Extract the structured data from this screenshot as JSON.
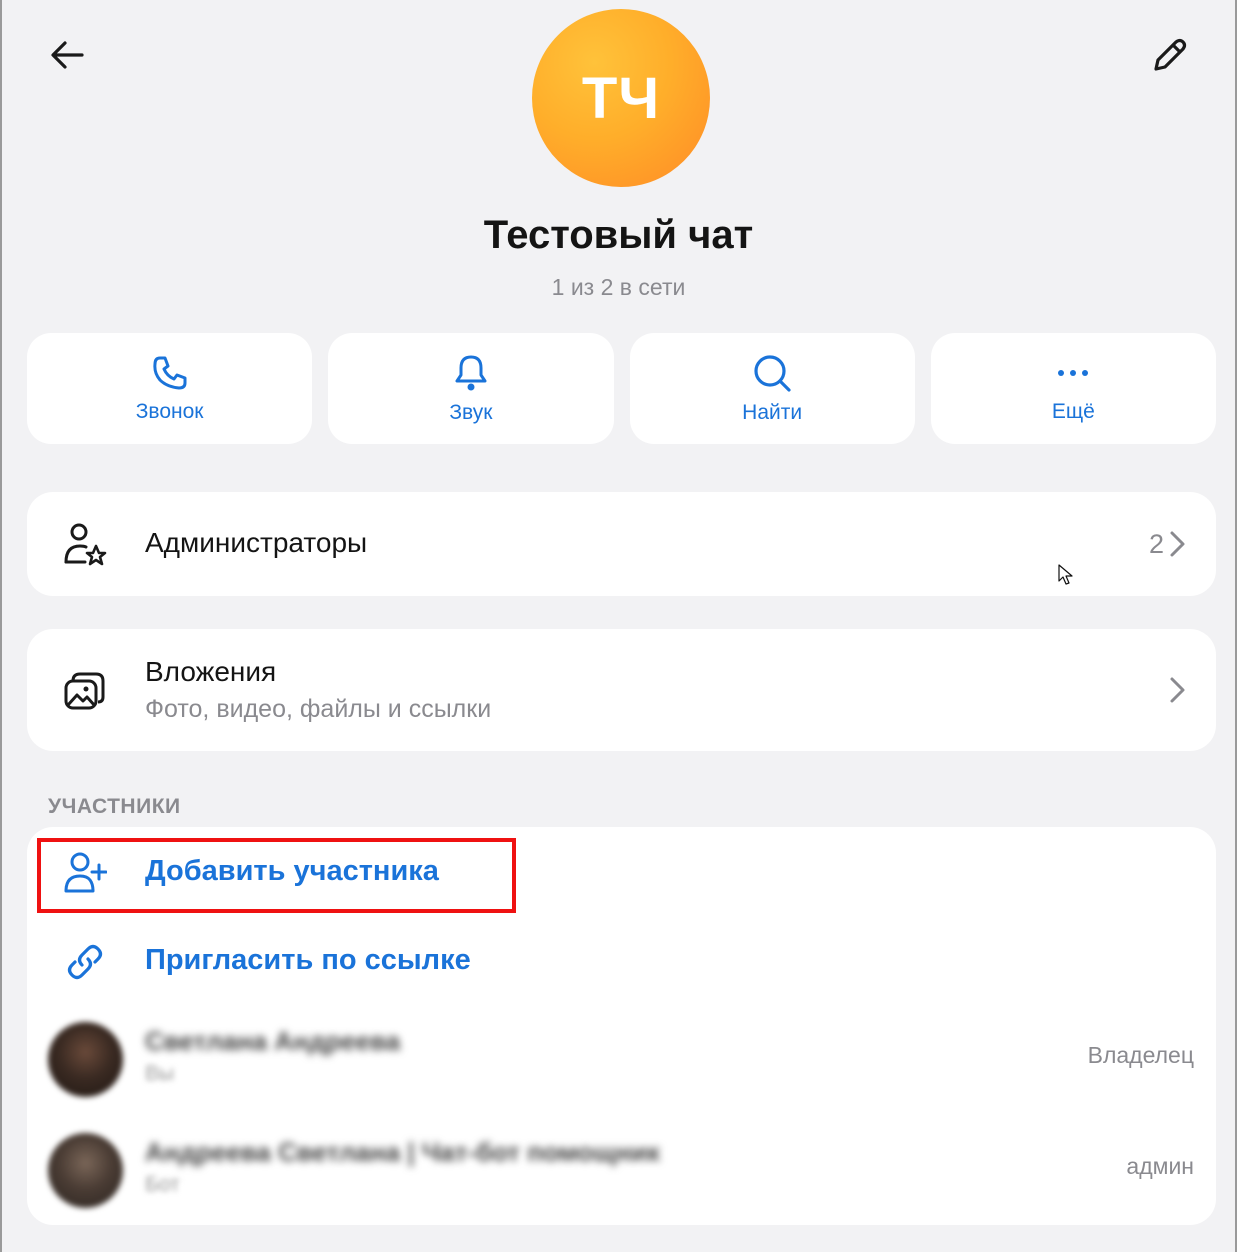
{
  "header": {
    "back_icon": "arrow-left-icon",
    "edit_icon": "pencil-icon"
  },
  "chat": {
    "initials": "ТЧ",
    "title": "Тестовый чат",
    "status": "1 из 2 в сети",
    "avatar_color_start": "#ffc23a",
    "avatar_color_end": "#ff8a26"
  },
  "actions": [
    {
      "label": "Звонок",
      "icon": "phone-icon"
    },
    {
      "label": "Звук",
      "icon": "bell-icon"
    },
    {
      "label": "Найти",
      "icon": "search-icon"
    },
    {
      "label": "Ещё",
      "icon": "more-icon"
    }
  ],
  "admins": {
    "title": "Администраторы",
    "count": "2",
    "icon": "user-star-icon"
  },
  "attachments": {
    "title": "Вложения",
    "subtitle": "Фото, видео, файлы и ссылки",
    "icon": "gallery-icon"
  },
  "members_section": {
    "header": "УЧАСТНИКИ",
    "add_member": "Добавить участника",
    "invite_link": "Пригласить по ссылке",
    "members": [
      {
        "name": "Светлана Андреева",
        "sub": "Вы",
        "role": "Владелец"
      },
      {
        "name": "Андреева Светлана | Чат-бот помощник",
        "sub": "Бот",
        "role": "админ"
      }
    ]
  },
  "colors": {
    "accent": "#1a73d9",
    "highlight": "#ef1111",
    "background": "#f2f2f4"
  }
}
